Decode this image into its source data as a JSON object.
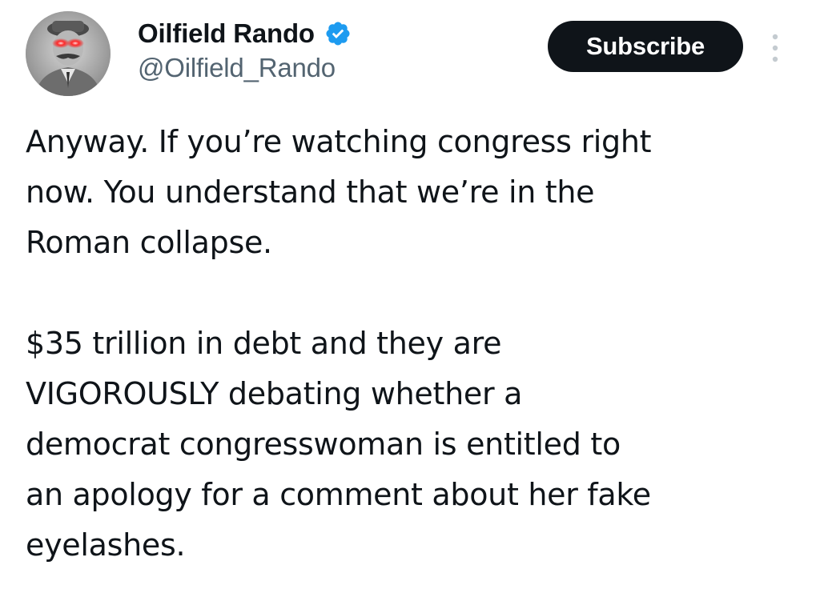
{
  "author": {
    "display_name": "Oilfield Rando",
    "handle": "@Oilfield_Rando",
    "verified": true,
    "avatar_icon": "laser-eyes-portrait-avatar",
    "verified_icon": "verified-badge-icon",
    "verified_color": "#1d9bf0"
  },
  "actions": {
    "subscribe_label": "Subscribe",
    "more_icon": "more-vertical-icon"
  },
  "tweet": {
    "paragraphs": [
      "Anyway. If you’re watching congress right\nnow. You understand that we’re in the\nRoman collapse.",
      "$35 trillion in debt and they are\nVIGOROUSLY debating whether a\ndemocrat congresswoman is entitled to\nan apology for a comment about her fake\neyelashes."
    ]
  },
  "colors": {
    "text_primary": "#0f1419",
    "text_secondary": "#536471",
    "button_bg": "#0f1419",
    "button_text": "#ffffff"
  }
}
